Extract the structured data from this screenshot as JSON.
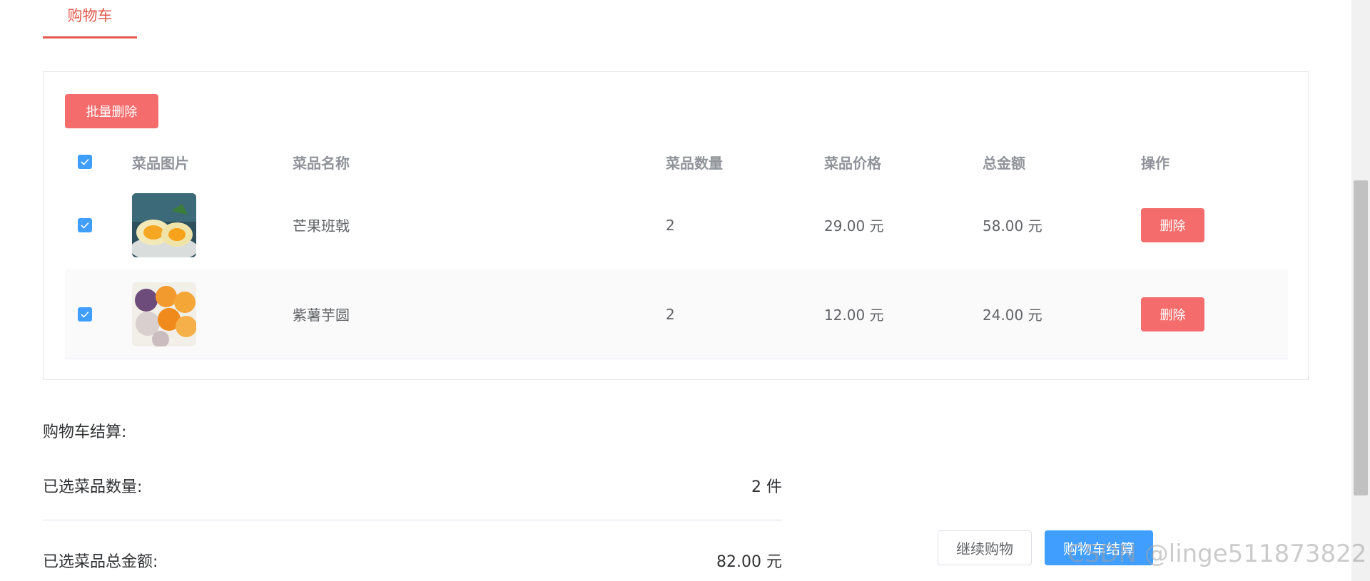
{
  "tabs": {
    "active_label": "购物车"
  },
  "toolbar": {
    "batch_delete_label": "批量删除"
  },
  "table": {
    "headers": {
      "image": "菜品图片",
      "name": "菜品名称",
      "quantity": "菜品数量",
      "price": "菜品价格",
      "total": "总金额",
      "operation": "操作"
    },
    "rows": [
      {
        "name": "芒果班戟",
        "quantity": "2",
        "price": "29.00 元",
        "total": "58.00 元",
        "delete_label": "删除",
        "checked": true,
        "image": "mango-pancake-photo"
      },
      {
        "name": "紫薯芋圆",
        "quantity": "2",
        "price": "12.00 元",
        "total": "24.00 元",
        "delete_label": "删除",
        "checked": true,
        "image": "taro-ball-photo"
      }
    ]
  },
  "summary": {
    "title": "购物车结算:",
    "selected_count_label": "已选菜品数量:",
    "selected_count_value": "2 件",
    "selected_total_label": "已选菜品总金额:",
    "selected_total_value": "82.00 元"
  },
  "actions": {
    "continue_label": "继续购物",
    "checkout_label": "购物车结算"
  },
  "watermark": "CSDN @linge511873822",
  "colors": {
    "accent": "#e2584c",
    "danger": "#f56c6c",
    "primary": "#409eff"
  }
}
